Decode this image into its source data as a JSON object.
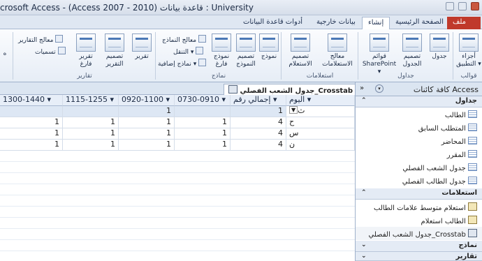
{
  "window": {
    "title": "crosoft Access - (Access 2007 - 2010) قاعدة بيانات : University"
  },
  "context_tabs": {
    "table_tools": "أدوات قاعدة البيانات"
  },
  "tabs": [
    "ملف",
    "الصفحة الرئيسية",
    "إنشاء",
    "بيانات خارجية",
    "أدوات قاعدة البيانات"
  ],
  "ribbon": {
    "templates": {
      "label": "قوالب",
      "app_parts": "أجزاء التطبيق ▾"
    },
    "tables": {
      "label": "جداول",
      "table": "جدول",
      "table_design": "تصميم الجدول",
      "sharepoint_lists": "قوائم SharePoint ▾"
    },
    "queries": {
      "label": "استعلامات",
      "query_wizard": "معالج الاستعلامات",
      "query_design": "تصميم الاستعلام"
    },
    "forms": {
      "label": "نماذج",
      "form": "نموذج",
      "form_design": "تصميم النموذج",
      "blank_form": "نموذج فارغ",
      "form_wizard": "معالج النماذج",
      "navigation": "التنقل ▾",
      "more_forms": "نماذج إضافية ▾"
    },
    "reports": {
      "label": "تقارير",
      "report": "تقرير",
      "report_design": "تصميم التقرير",
      "blank_report": "تقرير فارغ",
      "report_wizard": "معالج التقارير",
      "labels": "تسميات"
    },
    "macros_partial": "ه"
  },
  "document": {
    "tab_title": "جدول الشعب الفصلي_Crosstab"
  },
  "grid": {
    "columns": [
      "اليوم",
      "إجمالي رقم",
      "0730-0910",
      "0920-1100",
      "1115-1255",
      "1300-1440"
    ],
    "rows": [
      [
        "ث",
        "1",
        "",
        "1",
        "",
        ""
      ],
      [
        "ح",
        "4",
        "1",
        "1",
        "1",
        "1"
      ],
      [
        "س",
        "4",
        "1",
        "1",
        "1",
        "1"
      ],
      [
        "ن",
        "4",
        "1",
        "1",
        "1",
        "1"
      ]
    ]
  },
  "nav": {
    "title": "كافة كائنات Access",
    "categories": {
      "tables": {
        "label": "جداول",
        "items": [
          "الطالب",
          "المتطلب السابق",
          "المحاضر",
          "المقرر",
          "جدول الشعب الفصلي",
          "جدول الطالب الفصلي"
        ]
      },
      "queries": {
        "label": "استعلامات",
        "items": [
          "استعلام متوسط علامات الطالب",
          "الطالب استعلام",
          "جدول الشعب الفصلي_Crosstab"
        ]
      },
      "forms": {
        "label": "نماذج"
      },
      "reports": {
        "label": "تقارير"
      }
    }
  }
}
